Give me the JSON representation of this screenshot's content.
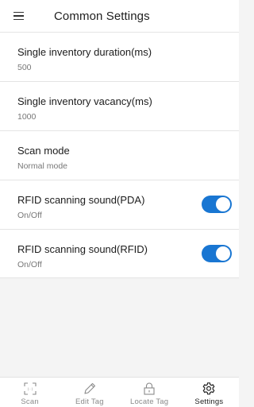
{
  "header": {
    "title": "Common Settings",
    "menu_icon": "hamburger-menu-icon"
  },
  "settings": [
    {
      "label": "Single inventory duration(ms)",
      "value": "500"
    },
    {
      "label": "Single inventory vacancy(ms)",
      "value": "1000"
    },
    {
      "label": "Scan mode",
      "value": "Normal mode"
    },
    {
      "label": "RFID scanning sound(PDA)",
      "value": "On/Off",
      "toggle_on": true
    },
    {
      "label": "RFID scanning sound(RFID)",
      "value": "On/Off",
      "toggle_on": true
    }
  ],
  "bottom_nav": [
    {
      "label": "Scan",
      "icon": "scan-frame-icon",
      "active": false
    },
    {
      "label": "Edit Tag",
      "icon": "pencil-icon",
      "active": false
    },
    {
      "label": "Locate Tag",
      "icon": "lock-icon",
      "active": false
    },
    {
      "label": "Settings",
      "icon": "gear-icon",
      "active": true
    }
  ],
  "colors": {
    "accent": "#1976d2",
    "background": "#f4f4f4",
    "surface": "#ffffff",
    "divider": "#e4e4e4"
  }
}
